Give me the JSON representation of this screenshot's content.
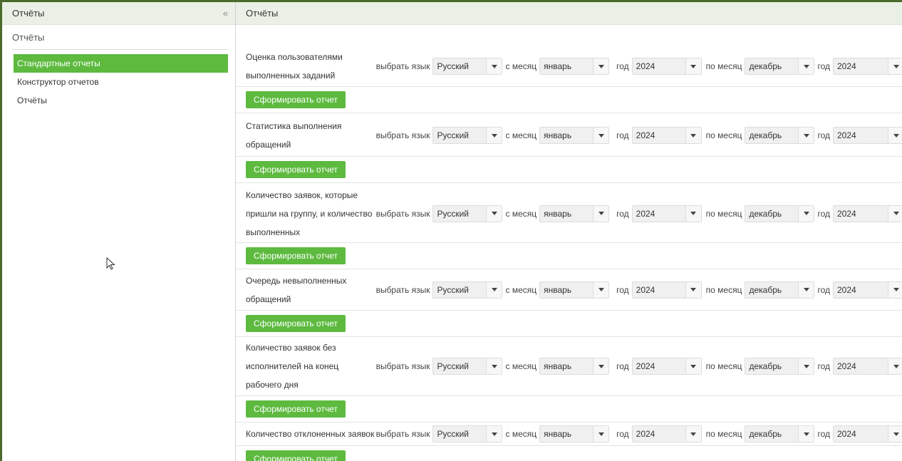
{
  "sidebar": {
    "header_title": "Отчёты",
    "collapse_glyph": "«",
    "section_title": "Отчёты",
    "items": [
      {
        "label": "Стандартные отчеты",
        "active": true
      },
      {
        "label": "Конструктор отчетов",
        "active": false
      },
      {
        "label": "Отчёты",
        "active": false
      }
    ]
  },
  "main": {
    "header_title": "Отчёты",
    "labels": {
      "language": "выбрать язык",
      "from_month": "с месяц",
      "year": "год",
      "to_month": "по месяц",
      "generate": "Сформировать отчет"
    },
    "defaults": {
      "language": "Русский",
      "from_month": "январь",
      "from_year": "2024",
      "to_month": "декабрь",
      "to_year": "2024"
    },
    "reports": [
      {
        "title": "Оценка пользователями выполненных заданий"
      },
      {
        "title": "Статистика выполнения обращений"
      },
      {
        "title": "Количество заявок, которые пришли на группу, и количество выполненных"
      },
      {
        "title": "Очередь невыполненных обращений"
      },
      {
        "title": "Количество заявок без исполнителей на конец рабочего дня"
      },
      {
        "title": "Количество отклоненных заявок"
      }
    ]
  },
  "icons": {
    "cursor": "mouse-pointer-icon",
    "collapse": "double-chevron-left-icon",
    "dropdown": "caret-down-icon"
  },
  "colors": {
    "accent_green": "#5dba3f",
    "header_bg": "#ebf0e6",
    "frame_border": "#4a6b2c"
  }
}
